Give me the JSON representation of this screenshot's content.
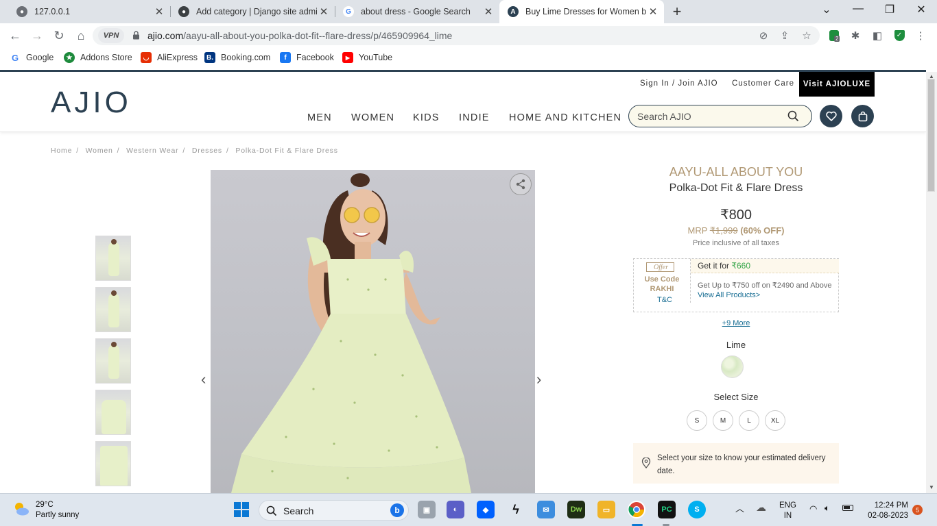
{
  "browser": {
    "tabs": [
      {
        "title": "127.0.0.1"
      },
      {
        "title": "Add category | Django site admin"
      },
      {
        "title": "about dress - Google Search"
      },
      {
        "title": "Buy Lime Dresses for Women by"
      }
    ],
    "url_host": "ajio.com",
    "url_path": "/aayu-all-about-you-polka-dot-fit--flare-dress/p/465909964_lime",
    "vpn_label": "VPN",
    "extension_badge": "2",
    "bookmarks": [
      {
        "label": "Google",
        "icon": "google-icon",
        "color": "#4285F4"
      },
      {
        "label": "Addons Store",
        "icon": "addons-store-icon",
        "color": "#1d8a3c"
      },
      {
        "label": "AliExpress",
        "icon": "aliexpress-icon",
        "color": "#e62e04"
      },
      {
        "label": "Booking.com",
        "icon": "booking-icon",
        "color": "#003580"
      },
      {
        "label": "Facebook",
        "icon": "facebook-icon",
        "color": "#1877f2"
      },
      {
        "label": "YouTube",
        "icon": "youtube-icon",
        "color": "#ff0000"
      }
    ]
  },
  "site": {
    "logo": "AJIO",
    "top_links": {
      "signin": "Sign In / Join AJIO",
      "care": "Customer Care",
      "luxe": "Visit AJIOLUXE"
    },
    "menu": [
      "MEN",
      "WOMEN",
      "KIDS",
      "INDIE",
      "HOME AND KITCHEN"
    ],
    "search_placeholder": "Search AJIO",
    "brand_color": "#2c4152"
  },
  "breadcrumb": [
    "Home",
    "Women",
    "Western Wear",
    "Dresses",
    "Polka-Dot Fit & Flare Dress"
  ],
  "product": {
    "brand": "AAYU-ALL ABOUT YOU",
    "name": "Polka-Dot Fit & Flare Dress",
    "price": "₹800",
    "mrp_label": "MRP",
    "mrp": "₹1,999",
    "discount": "(60% OFF)",
    "tax_note": "Price inclusive of all taxes",
    "offer": {
      "tag": "Offer",
      "use_code": "Use Code",
      "code": "RAKHI",
      "tc": "T&C",
      "get_it_for": "Get it for",
      "get_it_price": "₹660",
      "desc": "Get Up to ₹750 off on ₹2490 and Above",
      "view_all": "View All Products>"
    },
    "more_offers": "+9 More",
    "color": "Lime",
    "size_label": "Select Size",
    "sizes": [
      "S",
      "M",
      "L",
      "XL"
    ],
    "delivery_note": "Select your size to know your estimated delivery date."
  },
  "taskbar": {
    "temperature": "29°C",
    "weather": "Partly sunny",
    "search_label": "Search",
    "lang": "ENG",
    "region": "IN",
    "time": "12:24 PM",
    "date": "02-08-2023",
    "notifications": "5"
  }
}
